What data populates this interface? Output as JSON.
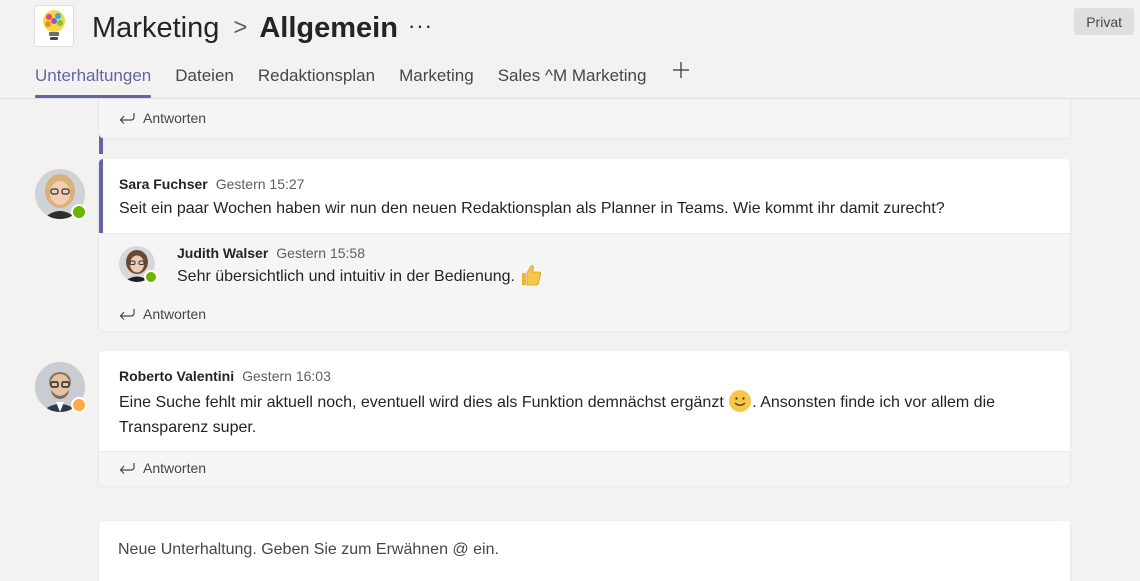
{
  "header": {
    "team_name": "Marketing",
    "separator": ">",
    "channel_name": "Allgemein",
    "more": "···",
    "privacy_badge": "Privat"
  },
  "tabs": [
    {
      "label": "Unterhaltungen",
      "active": true
    },
    {
      "label": "Dateien",
      "active": false
    },
    {
      "label": "Redaktionsplan",
      "active": false
    },
    {
      "label": "Marketing",
      "active": false
    },
    {
      "label": "Sales ^M Marketing",
      "active": false
    }
  ],
  "reply_label": "Antworten",
  "threads": [
    {
      "author": "Sara Fuchser",
      "time": "Gestern 15:27",
      "text": "Seit ein paar Wochen haben wir nun den neuen Redaktionsplan als Planner in Teams. Wie kommt ihr damit zurecht?",
      "status": "available",
      "replies": [
        {
          "author": "Judith Walser",
          "time": "Gestern 15:58",
          "text": "Sehr übersichtlich und intuitiv in der Bedienung.",
          "emoji": "thumbs-up",
          "status": "available"
        }
      ]
    },
    {
      "author": "Roberto Valentini",
      "time": "Gestern 16:03",
      "text_part1": "Eine Suche fehlt mir aktuell noch, eventuell wird dies als Funktion demnächst ergänzt",
      "emoji": "smile",
      "text_part2": ". Ansonsten finde ich vor allem die",
      "text_line2": "Transparenz super.",
      "status": "away"
    }
  ],
  "compose": {
    "placeholder": "Neue Unterhaltung. Geben Sie zum Erwähnen @ ein."
  },
  "colors": {
    "accent": "#6264a7",
    "available": "#6bb700",
    "away": "#ffaa44",
    "background": "#f3f2f1"
  }
}
